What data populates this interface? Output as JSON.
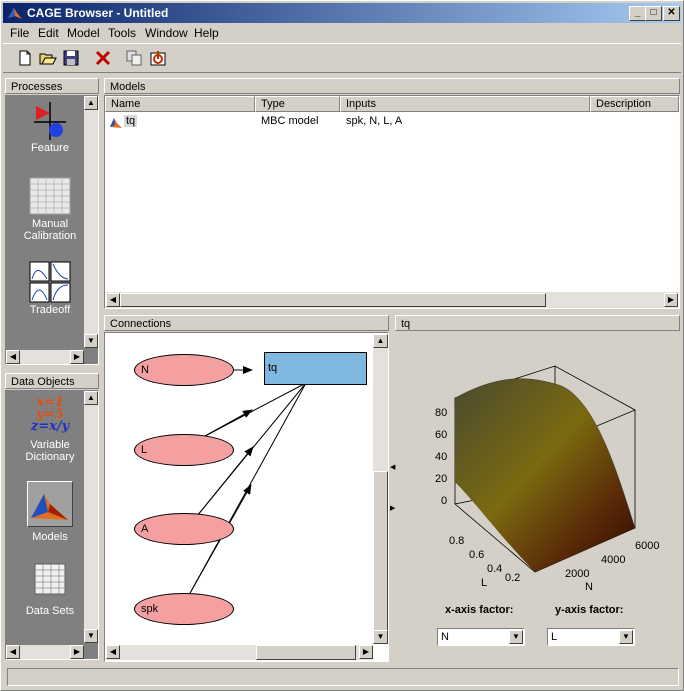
{
  "window": {
    "title": "CAGE Browser - Untitled"
  },
  "title_buttons": {
    "minimize": "_",
    "maximize": "□",
    "close": "✕"
  },
  "menu": [
    "File",
    "Edit",
    "Model",
    "Tools",
    "Window",
    "Help"
  ],
  "toolbar": {
    "icons": [
      "new-icon",
      "open-icon",
      "save-icon",
      "delete-icon",
      "copy-icon",
      "import-icon"
    ]
  },
  "processes": {
    "header": "Processes",
    "items": [
      {
        "label": "Feature",
        "icon": "feature-icon"
      },
      {
        "label": "Manual Calibration",
        "icon": "manual-calibration-icon"
      },
      {
        "label": "Tradeoff",
        "icon": "tradeoff-icon"
      }
    ]
  },
  "data_objects": {
    "header": "Data Objects",
    "items": [
      {
        "label": "Variable Dictionary",
        "icon": "variable-dictionary-icon",
        "glyph": [
          "x=1",
          "y=5",
          "z=x/y"
        ]
      },
      {
        "label": "Models",
        "icon": "models-icon"
      },
      {
        "label": "Data Sets",
        "icon": "data-sets-icon"
      }
    ]
  },
  "models": {
    "header": "Models",
    "columns": [
      "Name",
      "Type",
      "Inputs",
      "Description"
    ],
    "rows": [
      {
        "name": "tq",
        "type": "MBC model",
        "inputs": "spk, N, L, A",
        "description": ""
      }
    ]
  },
  "connections": {
    "header": "Connections",
    "nodes": [
      "N",
      "L",
      "A",
      "spk"
    ],
    "target": "tq"
  },
  "plot": {
    "header": "tq",
    "z_ticks": [
      "80",
      "60",
      "40",
      "20",
      "0"
    ],
    "l_ticks": [
      "0.8",
      "0.6",
      "0.4",
      "0.2"
    ],
    "n_ticks": [
      "2000",
      "4000",
      "6000"
    ],
    "l_label": "L",
    "n_label": "N"
  },
  "factors": {
    "x_label": "x-axis factor:",
    "x_value": "N",
    "y_label": "y-axis factor:",
    "y_value": "L"
  },
  "colors": {
    "title_start": "#0a246a",
    "title_end": "#a6caf0",
    "node_fill": "#f4a0a0",
    "target_fill": "#80b8e0"
  }
}
